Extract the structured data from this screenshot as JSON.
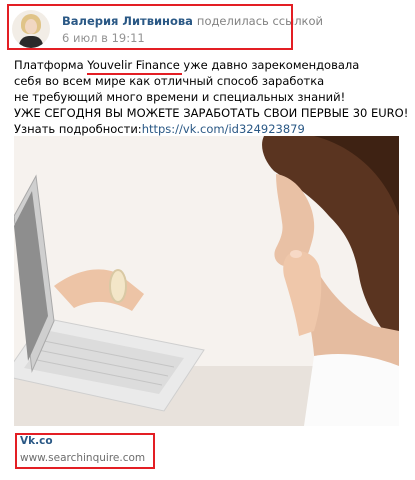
{
  "post": {
    "author": "Валерия Литвинова",
    "action": "поделилась ссылкой",
    "date": "6 июл в 19:11",
    "text": {
      "line1_prefix": "Платформа ",
      "line1_brand": "Youvelir Finance",
      "line1_suffix": " уже давно зарекомендовала",
      "line2": "себя во всем мире как отличный способ заработка",
      "line3": "не требующий много времени и специальных знаний!",
      "line4": "УЖЕ СЕГОДНЯ ВЫ МОЖЕТЕ ЗАРАБОТАТЬ СВОИ ПЕРВЫЕ 30 EURO!",
      "line5_prefix": "Узнать подробности:",
      "line5_link": "https://vk.com/id324923879"
    },
    "image_icon": "woman-with-laptop-photo",
    "link_card": {
      "title": "Vk.co",
      "url": "www.searchinquire.com"
    }
  },
  "colors": {
    "link": "#2a5885",
    "highlight": "#e31e24",
    "meta": "#939393"
  }
}
